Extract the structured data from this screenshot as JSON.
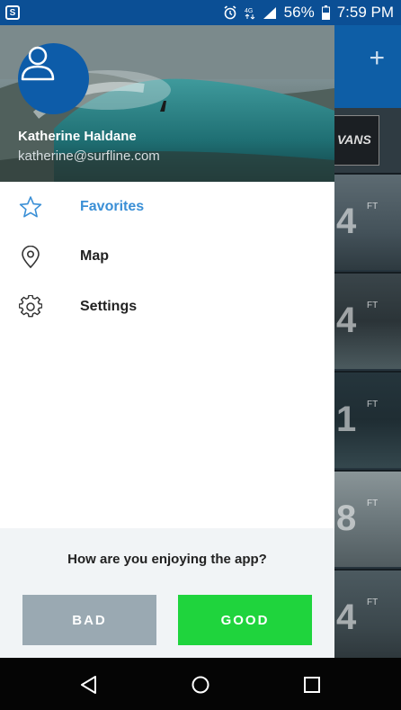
{
  "status_bar": {
    "app_icon": "S",
    "battery": "56%",
    "time": "7:59 PM"
  },
  "background_app": {
    "plus_icon": "+",
    "ad_text": "VANS",
    "cards": [
      {
        "value": "4",
        "unit": "FT"
      },
      {
        "value": "4",
        "unit": "FT"
      },
      {
        "value": "1",
        "unit": "FT"
      },
      {
        "value": "8",
        "unit": "FT"
      },
      {
        "value": "4",
        "unit": "FT"
      }
    ]
  },
  "drawer": {
    "user": {
      "name": "Katherine Haldane",
      "email": "katherine@surfline.com"
    },
    "menu": [
      {
        "label": "Favorites",
        "icon": "star-icon",
        "active": true
      },
      {
        "label": "Map",
        "icon": "map-pin-icon",
        "active": false
      },
      {
        "label": "Settings",
        "icon": "gear-icon",
        "active": false
      }
    ],
    "rating": {
      "question": "How are you enjoying the app?",
      "bad_label": "BAD",
      "good_label": "GOOD"
    }
  },
  "colors": {
    "status_bar": "#0b4f95",
    "accent": "#3a8fd6",
    "good": "#1fd43d",
    "bad": "#9aa9b2"
  }
}
